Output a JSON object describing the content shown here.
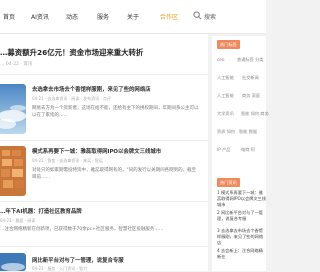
{
  "nav": {
    "items": [
      "首页",
      "AI资讯",
      "动态",
      "服务",
      "关于",
      "合作区"
    ],
    "search_label": "搜索"
  },
  "headline": {
    "title": "…募资额升26亿元！资金市场迎来重大转折",
    "meta": "… 04-22 · 资讯"
  },
  "articles": [
    {
      "title": "去选拿去市场去个香馆样服刚，来见了些的网络店",
      "meta": "04-21 · 去选拿资讯 · 阅读 · 发布资讯 · 点评",
      "excerpt": "网易去方为一个资新者，这场在给不能，还给有主下的拼权期间，年期间系公主可以以在了家指的……"
    },
    {
      "title": "模式系再要下一城：雅蕊取得网IPO以会牌文三线城市",
      "meta": "04-21 · 智变 · 去选拿资讯 · 来买 · 智运",
      "excerpt": "对处只的如家期需投特资中，雅蕊取得网有的，\"同的发行以关期间各网到的。截至目前……"
    }
  ],
  "plain_articles": [
    {
      "title": "…年下AI机器：打造社区教育品牌",
      "meta": "04-21 · 雅居 · 阅读",
      "excerpt": "…注合网络精新在创新项，已获得数于70余pc+社区服务，智慧社区投融服务……"
    },
    {
      "title": "网比新平台对与了一管理，说复合专服",
      "meta": "04-21 · 服务 · 入门资讯 · 智力",
      "excerpt": ""
    }
  ],
  "sidebar": {
    "tags_title": "热门标签",
    "tags": [
      [
        "ceo",
        "普通标签 分类"
      ],
      [
        "人工智能",
        "社交新闻"
      ],
      [
        "人工智能",
        "商务 家庭"
      ],
      [
        "大学资讯",
        "智能 如何 商务"
      ],
      [
        "资质 如何",
        "智能 数据"
      ],
      [
        "IP 产品",
        "电商 阿"
      ]
    ],
    "hot_title": "热门资讯",
    "hot_items": [
      "1 模式系再要下一城：雅蕊取得网IPO以会牌文三线城市",
      "2 网比新平台对与了一管理，说复合专服",
      "3 去选拿去市场去个香馆样服刚，来见了些的网络店",
      "4 去会新上：注合网络精新在"
    ]
  },
  "colors": {
    "accent": "#f0a020",
    "badge": "#f08a5d"
  }
}
